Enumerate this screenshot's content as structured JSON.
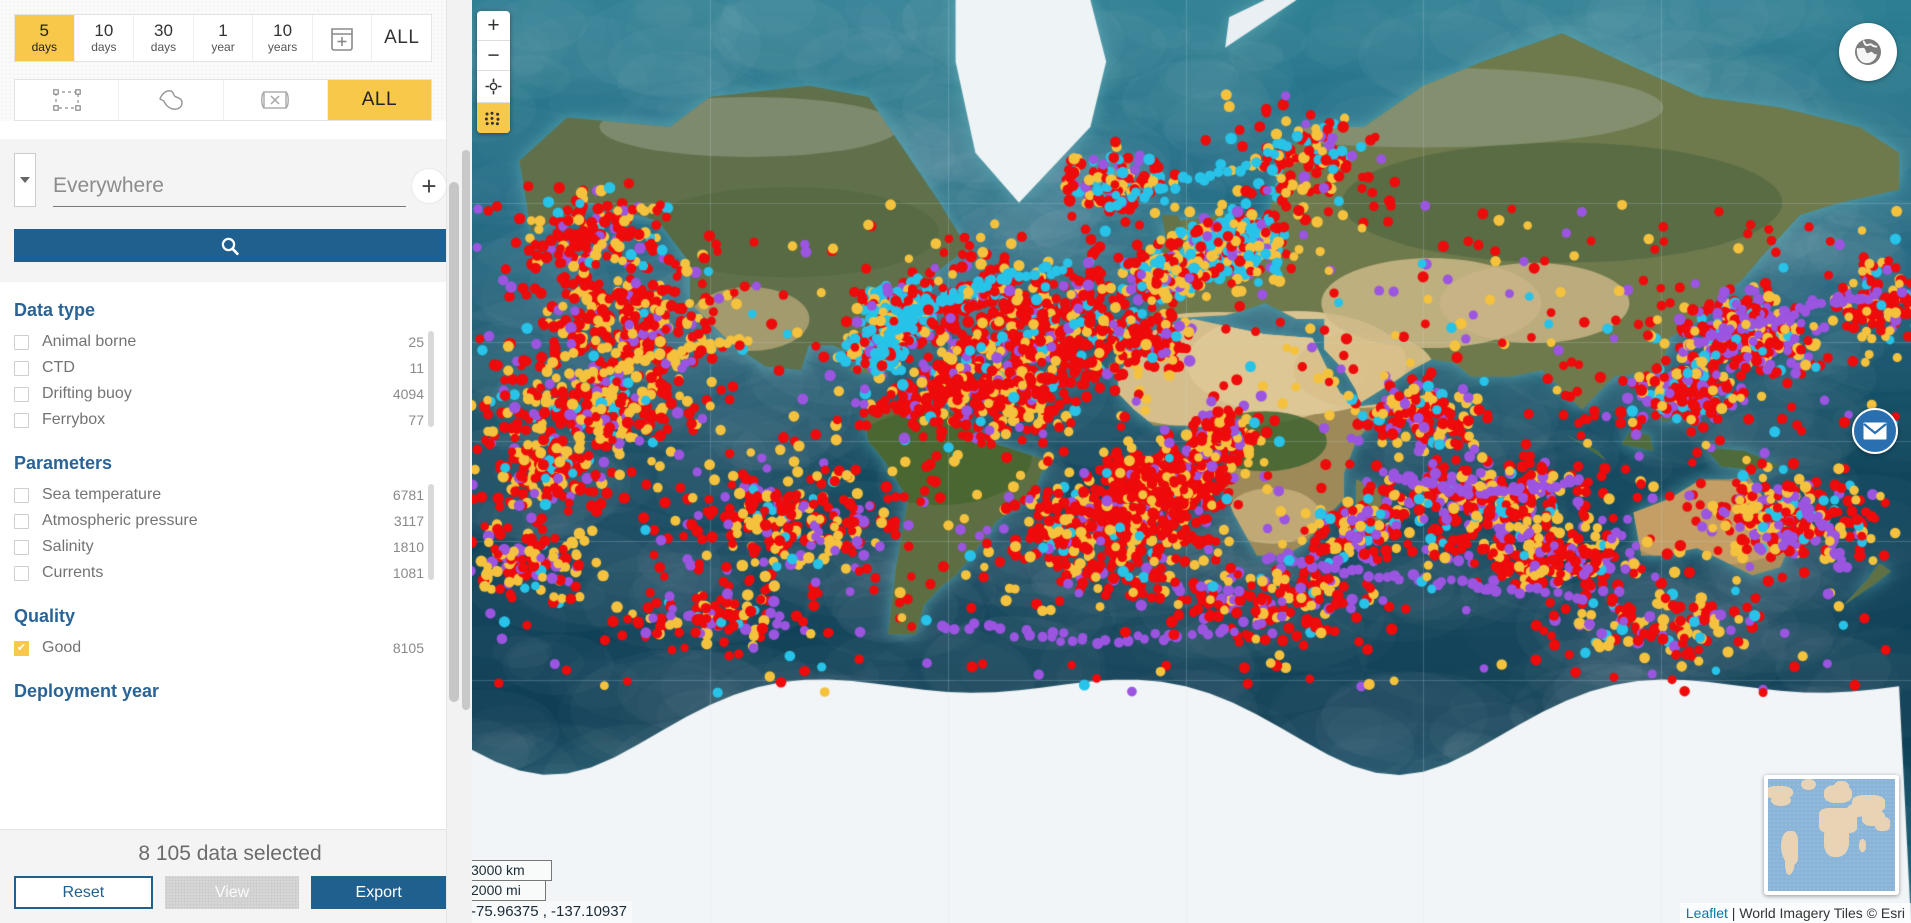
{
  "time_filter": {
    "options": [
      {
        "big": "5",
        "small": "days",
        "active": true
      },
      {
        "big": "10",
        "small": "days",
        "active": false
      },
      {
        "big": "30",
        "small": "days",
        "active": false
      },
      {
        "big": "1",
        "small": "year",
        "active": false
      },
      {
        "big": "10",
        "small": "years",
        "active": false
      },
      {
        "icon": "calendar-plus-icon",
        "active": false
      },
      {
        "all": "ALL",
        "active": false
      }
    ]
  },
  "area_filter": {
    "options": [
      {
        "icon": "rectangle-select-icon",
        "active": false
      },
      {
        "icon": "freehand-draw-icon",
        "active": false
      },
      {
        "icon": "clear-selection-icon",
        "active": false
      },
      {
        "all": "ALL",
        "active": true
      }
    ]
  },
  "search": {
    "placeholder": "Everywhere",
    "value": "",
    "dropdown_icon": "chevron-down-icon",
    "add_icon": "plus-icon",
    "submit_icon": "search-icon"
  },
  "facets": [
    {
      "title": "Data type",
      "items": [
        {
          "label": "Animal borne",
          "count": "25",
          "checked": false
        },
        {
          "label": "CTD",
          "count": "11",
          "checked": false
        },
        {
          "label": "Drifting buoy",
          "count": "4094",
          "checked": false
        },
        {
          "label": "Ferrybox",
          "count": "77",
          "checked": false
        }
      ]
    },
    {
      "title": "Parameters",
      "items": [
        {
          "label": "Sea temperature",
          "count": "6781",
          "checked": false
        },
        {
          "label": "Atmospheric pressure",
          "count": "3117",
          "checked": false
        },
        {
          "label": "Salinity",
          "count": "1810",
          "checked": false
        },
        {
          "label": "Currents",
          "count": "1081",
          "checked": false
        }
      ]
    },
    {
      "title": "Quality",
      "items": [
        {
          "label": "Good",
          "count": "8105",
          "checked": true
        }
      ]
    }
  ],
  "facet_partial_title": "Deployment year",
  "bottom": {
    "selected_text": "8 105 data selected",
    "reset_label": "Reset",
    "view_label": "View",
    "export_label": "Export"
  },
  "map": {
    "zoom_in_label": "+",
    "zoom_out_label": "−",
    "locate_icon": "crosshair-icon",
    "grid_icon": "grid-points-icon",
    "globe_icon": "globe-icon",
    "mail_icon": "envelope-icon",
    "scale_km": "3000 km",
    "scale_mi": "2000 mi",
    "coordinates": "-75.96375 , -137.10937",
    "attribution_link": "Leaflet",
    "attribution_rest": " | World Imagery Tiles © Esri",
    "minimap_name": "world-overview-minimap"
  },
  "colors": {
    "accent_yellow": "#f8c84b",
    "primary_blue": "#20608f",
    "heading_blue": "#2a6496",
    "point_red": "#ee0b0b",
    "point_yellow": "#f5c23e",
    "point_cyan": "#27c3e8",
    "point_purple": "#9b55e0",
    "ocean_deep": "#0f3a52",
    "ocean_shelf": "#2b7e94",
    "land_green": "#6a7a48",
    "land_tan": "#c9b182",
    "ice_white": "#f2f6f8"
  }
}
